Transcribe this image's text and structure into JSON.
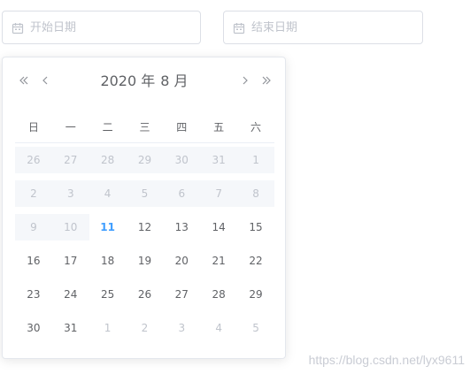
{
  "start_input": {
    "placeholder": "开始日期",
    "value": "",
    "icon": "calendar-icon"
  },
  "end_input": {
    "placeholder": "结束日期",
    "value": "",
    "icon": "calendar-icon"
  },
  "picker": {
    "year": "2020",
    "year_suffix": "年",
    "month": "8",
    "month_suffix": "月",
    "nav": {
      "prev_year_icon": "double-chevron-left-icon",
      "prev_month_icon": "chevron-left-icon",
      "next_month_icon": "chevron-right-icon",
      "next_year_icon": "double-chevron-right-icon"
    },
    "weekdays": [
      "日",
      "一",
      "二",
      "三",
      "四",
      "五",
      "六"
    ],
    "weeks": [
      [
        {
          "d": "26",
          "t": "prev",
          "dis": true
        },
        {
          "d": "27",
          "t": "prev",
          "dis": true
        },
        {
          "d": "28",
          "t": "prev",
          "dis": true
        },
        {
          "d": "29",
          "t": "prev",
          "dis": true
        },
        {
          "d": "30",
          "t": "prev",
          "dis": true
        },
        {
          "d": "31",
          "t": "prev",
          "dis": true
        },
        {
          "d": "1",
          "t": "cur",
          "dis": true
        }
      ],
      [
        {
          "d": "2",
          "t": "cur",
          "dis": true
        },
        {
          "d": "3",
          "t": "cur",
          "dis": true
        },
        {
          "d": "4",
          "t": "cur",
          "dis": true
        },
        {
          "d": "5",
          "t": "cur",
          "dis": true
        },
        {
          "d": "6",
          "t": "cur",
          "dis": true
        },
        {
          "d": "7",
          "t": "cur",
          "dis": true
        },
        {
          "d": "8",
          "t": "cur",
          "dis": true
        }
      ],
      [
        {
          "d": "9",
          "t": "cur",
          "dis": true
        },
        {
          "d": "10",
          "t": "cur",
          "dis": true
        },
        {
          "d": "11",
          "t": "cur",
          "today": true
        },
        {
          "d": "12",
          "t": "cur"
        },
        {
          "d": "13",
          "t": "cur"
        },
        {
          "d": "14",
          "t": "cur"
        },
        {
          "d": "15",
          "t": "cur"
        }
      ],
      [
        {
          "d": "16",
          "t": "cur"
        },
        {
          "d": "17",
          "t": "cur"
        },
        {
          "d": "18",
          "t": "cur"
        },
        {
          "d": "19",
          "t": "cur"
        },
        {
          "d": "20",
          "t": "cur"
        },
        {
          "d": "21",
          "t": "cur"
        },
        {
          "d": "22",
          "t": "cur"
        }
      ],
      [
        {
          "d": "23",
          "t": "cur"
        },
        {
          "d": "24",
          "t": "cur"
        },
        {
          "d": "25",
          "t": "cur"
        },
        {
          "d": "26",
          "t": "cur"
        },
        {
          "d": "27",
          "t": "cur"
        },
        {
          "d": "28",
          "t": "cur"
        },
        {
          "d": "29",
          "t": "cur"
        }
      ],
      [
        {
          "d": "30",
          "t": "cur"
        },
        {
          "d": "31",
          "t": "cur"
        },
        {
          "d": "1",
          "t": "next"
        },
        {
          "d": "2",
          "t": "next"
        },
        {
          "d": "3",
          "t": "next"
        },
        {
          "d": "4",
          "t": "next"
        },
        {
          "d": "5",
          "t": "next"
        }
      ]
    ]
  },
  "watermark": "https://blog.csdn.net/lyx9611",
  "colors": {
    "today": "#409eff",
    "disabled_bg": "#f5f7fa",
    "muted_text": "#c0c4cc",
    "text": "#606266",
    "border": "#dcdfe6"
  }
}
